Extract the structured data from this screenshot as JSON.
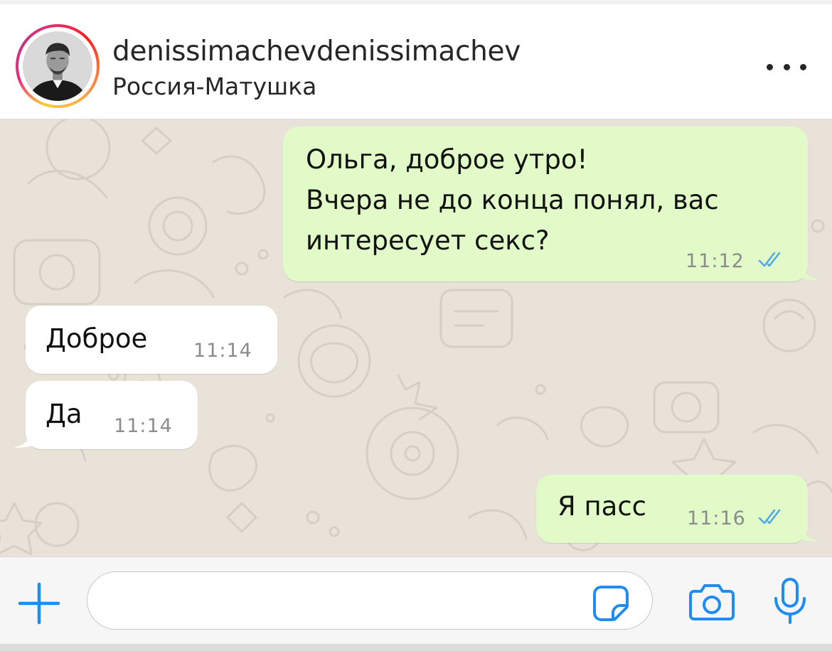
{
  "header": {
    "username": "denissimachevdenissimachev",
    "location": "Россия-Матушка",
    "more_icon": "ellipsis-icon"
  },
  "messages": [
    {
      "direction": "outgoing",
      "text": "Ольга, доброе утро!\nВчера не до конца понял, вас\nинтересует секс?",
      "time": "11:12",
      "status": "read"
    },
    {
      "direction": "incoming",
      "text": "Доброе",
      "time": "11:14"
    },
    {
      "direction": "incoming",
      "text": "Да",
      "time": "11:14"
    },
    {
      "direction": "outgoing",
      "text": "Я пасс",
      "time": "11:16",
      "status": "read"
    }
  ],
  "input_bar": {
    "message_placeholder": "",
    "message_value": "",
    "icons": [
      "plus-icon",
      "sticker-icon",
      "camera-icon",
      "microphone-icon"
    ]
  },
  "colors": {
    "accent_blue": "#1f8cf2",
    "outgoing_bubble": "#e1fac8",
    "incoming_bubble": "#ffffff",
    "chat_background": "#e8e2d9",
    "read_ticks": "#4fa8e8"
  }
}
